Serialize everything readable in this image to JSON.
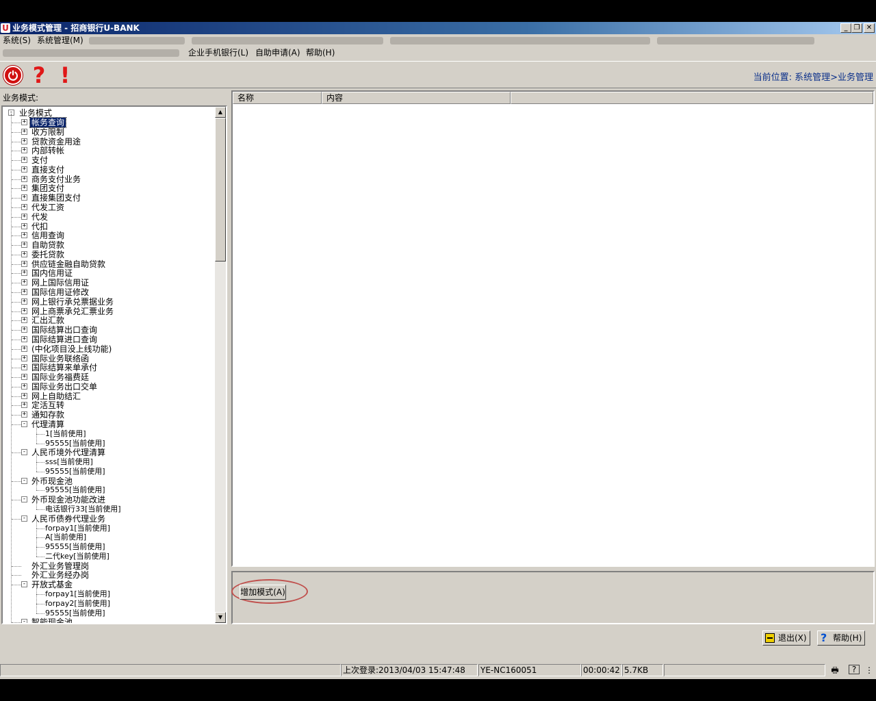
{
  "window": {
    "logo": "U",
    "title": "业务模式管理 - 招商银行U-BANK",
    "minimize": "_",
    "restore": "❐",
    "close": "✕"
  },
  "menu_row1": [
    {
      "label": "系统(S)"
    },
    {
      "label": "系统管理(M)"
    }
  ],
  "menu_row2": [
    {
      "label": "企业手机银行(L)"
    },
    {
      "label": "自助申请(A)"
    },
    {
      "label": "帮助(H)"
    }
  ],
  "toolbar": {
    "power_glyph": "⏻",
    "question_glyph": "?",
    "exclaim_glyph": "!",
    "location": "当前位置: 系统管理>业务管理"
  },
  "left": {
    "label": "业务模式:",
    "scroll_up": "▲",
    "scroll_down": "▼",
    "root": "业务模式",
    "nodes": [
      {
        "text": "帐务查询",
        "level": 1,
        "expander": "+",
        "selected": true
      },
      {
        "text": "收方限制",
        "level": 1,
        "expander": "+"
      },
      {
        "text": "贷款资金用途",
        "level": 1,
        "expander": "+"
      },
      {
        "text": "内部转帐",
        "level": 1,
        "expander": "+"
      },
      {
        "text": "支付",
        "level": 1,
        "expander": "+"
      },
      {
        "text": "直接支付",
        "level": 1,
        "expander": "+"
      },
      {
        "text": "商务支付业务",
        "level": 1,
        "expander": "+"
      },
      {
        "text": "集团支付",
        "level": 1,
        "expander": "+"
      },
      {
        "text": "直接集团支付",
        "level": 1,
        "expander": "+"
      },
      {
        "text": "代发工资",
        "level": 1,
        "expander": "+"
      },
      {
        "text": "代发",
        "level": 1,
        "expander": "+"
      },
      {
        "text": "代扣",
        "level": 1,
        "expander": "+"
      },
      {
        "text": "信用查询",
        "level": 1,
        "expander": "+"
      },
      {
        "text": "自助贷款",
        "level": 1,
        "expander": "+"
      },
      {
        "text": "委托贷款",
        "level": 1,
        "expander": "+"
      },
      {
        "text": "供应链金融自助贷款",
        "level": 1,
        "expander": "+"
      },
      {
        "text": "国内信用证",
        "level": 1,
        "expander": "+"
      },
      {
        "text": "网上国际信用证",
        "level": 1,
        "expander": "+"
      },
      {
        "text": "国际信用证修改",
        "level": 1,
        "expander": "+"
      },
      {
        "text": "网上银行承兑票据业务",
        "level": 1,
        "expander": "+"
      },
      {
        "text": "网上商票承兑汇票业务",
        "level": 1,
        "expander": "+"
      },
      {
        "text": "汇出汇款",
        "level": 1,
        "expander": "+"
      },
      {
        "text": "国际结算出口查询",
        "level": 1,
        "expander": "+"
      },
      {
        "text": "国际结算进口查询",
        "level": 1,
        "expander": "+"
      },
      {
        "text": "(中化项目没上线功能)",
        "level": 1,
        "expander": "+"
      },
      {
        "text": "国际业务联络函",
        "level": 1,
        "expander": "+"
      },
      {
        "text": "国际结算来单承付",
        "level": 1,
        "expander": "+"
      },
      {
        "text": "国际业务福费廷",
        "level": 1,
        "expander": "+"
      },
      {
        "text": "国际业务出口交单",
        "level": 1,
        "expander": "+"
      },
      {
        "text": "网上自助结汇",
        "level": 1,
        "expander": "+"
      },
      {
        "text": "定活互转",
        "level": 1,
        "expander": "+"
      },
      {
        "text": "通知存款",
        "level": 1,
        "expander": "+"
      },
      {
        "text": "代理清算",
        "level": 1,
        "expander": "-"
      },
      {
        "text": "1[当前使用]",
        "level": 2
      },
      {
        "text": "95555[当前使用]",
        "level": 2
      },
      {
        "text": "人民币境外代理清算",
        "level": 1,
        "expander": "-"
      },
      {
        "text": "sss[当前使用]",
        "level": 2
      },
      {
        "text": "95555[当前使用]",
        "level": 2
      },
      {
        "text": "外币现金池",
        "level": 1,
        "expander": "-"
      },
      {
        "text": "95555[当前使用]",
        "level": 2
      },
      {
        "text": "外币现金池功能改进",
        "level": 1,
        "expander": "-"
      },
      {
        "text": "电话银行33[当前使用]",
        "level": 2
      },
      {
        "text": "人民币债券代理业务",
        "level": 1,
        "expander": "-"
      },
      {
        "text": "forpay1[当前使用]",
        "level": 2
      },
      {
        "text": "A[当前使用]",
        "level": 2
      },
      {
        "text": "95555[当前使用]",
        "level": 2
      },
      {
        "text": "二代key[当前使用]",
        "level": 2
      },
      {
        "text": "外汇业务管理岗",
        "level": 1
      },
      {
        "text": "外汇业务经办岗",
        "level": 1
      },
      {
        "text": "开放式基金",
        "level": 1,
        "expander": "-"
      },
      {
        "text": "forpay1[当前使用]",
        "level": 2
      },
      {
        "text": "forpay2[当前使用]",
        "level": 2
      },
      {
        "text": "95555[当前使用]",
        "level": 2
      },
      {
        "text": "智能现金池",
        "level": 1,
        "expander": "-"
      }
    ]
  },
  "listview": {
    "columns": [
      "名称",
      "内容",
      ""
    ]
  },
  "actions": {
    "add_mode": "增加模式(A)",
    "exit": "退出(X)",
    "help": "帮助(H)",
    "help_glyph": "?"
  },
  "status": {
    "last_login": "上次登录:2013/04/03 15:47:48",
    "user": "YE-NC160051",
    "elapsed": "00:00:42",
    "size": "5.7KB",
    "printer_glyph": "🖶",
    "help_glyph": "?",
    "more_glyph": "⋮"
  }
}
